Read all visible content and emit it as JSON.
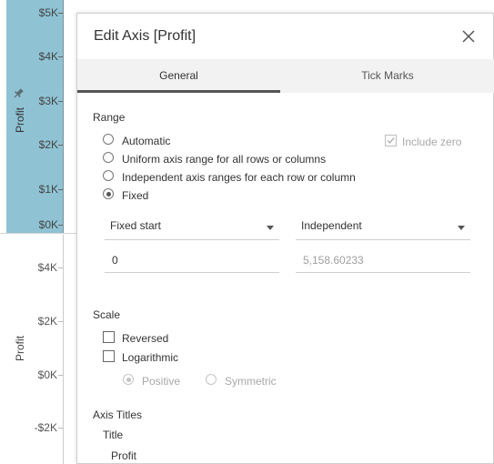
{
  "worksheet": {
    "top_pane": {
      "axis_title": "Profit",
      "ticks": [
        "$5K",
        "$4K",
        "$3K",
        "$2K",
        "$1K",
        "$0K"
      ]
    },
    "bottom_pane": {
      "axis_title": "Profit",
      "ticks": [
        "$4K",
        "$2K",
        "$0K",
        "-$2K"
      ]
    },
    "colors": {
      "highlight_pane": "#8fc3d4"
    }
  },
  "dialog": {
    "title": "Edit Axis [Profit]",
    "tabs": [
      {
        "label": "General",
        "active": true
      },
      {
        "label": "Tick Marks",
        "active": false
      }
    ],
    "range": {
      "section_label": "Range",
      "options": [
        {
          "label": "Automatic",
          "selected": false
        },
        {
          "label": "Uniform axis range for all rows or columns",
          "selected": false
        },
        {
          "label": "Independent axis ranges for each row or column",
          "selected": false
        },
        {
          "label": "Fixed",
          "selected": true
        }
      ],
      "include_zero": {
        "label": "Include zero",
        "checked": true,
        "disabled": true
      },
      "start_dropdown": "Fixed start",
      "end_dropdown": "Independent",
      "start_value": "0",
      "end_value": "5,158.60233"
    },
    "scale": {
      "section_label": "Scale",
      "reversed": {
        "label": "Reversed",
        "checked": false
      },
      "logarithmic": {
        "label": "Logarithmic",
        "checked": false
      },
      "log_positive": {
        "label": "Positive",
        "selected": true,
        "disabled": true
      },
      "log_symmetric": {
        "label": "Symmetric",
        "selected": false,
        "disabled": true
      }
    },
    "axis_titles": {
      "section_label": "Axis Titles",
      "title_label": "Title",
      "title_value": "Profit"
    }
  }
}
